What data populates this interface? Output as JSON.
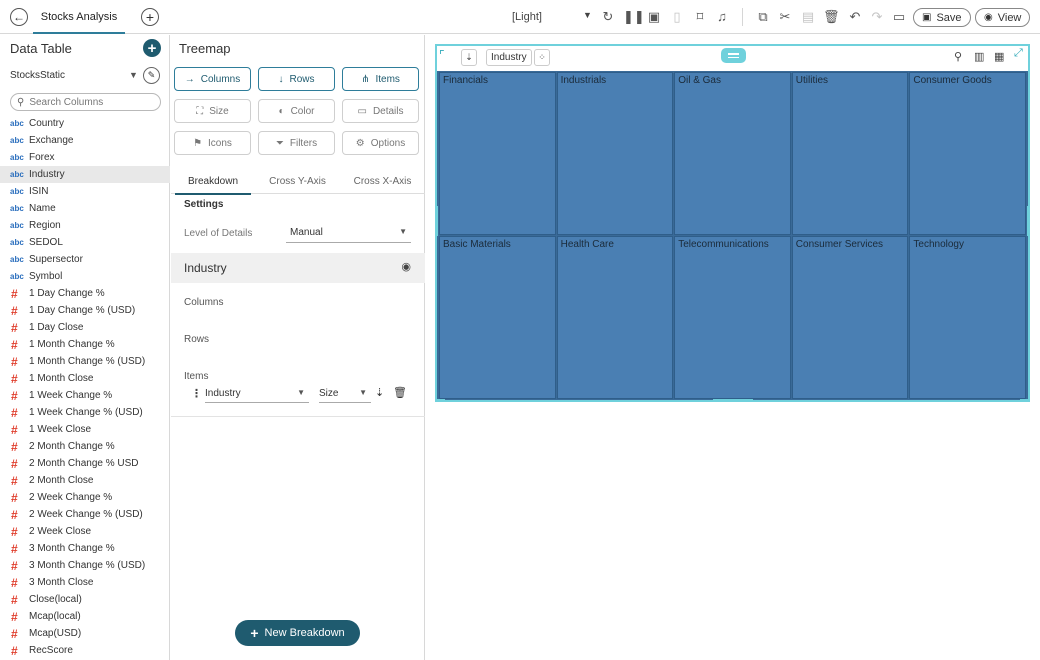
{
  "topbar": {
    "tab_label": "Stocks Analysis",
    "theme_value": "[Light]",
    "save_label": "Save",
    "view_label": "View"
  },
  "left_panel": {
    "title": "Data Table",
    "data_source": "StocksStatic",
    "search_placeholder": "Search Columns",
    "columns": [
      {
        "type": "abc",
        "name": "Country"
      },
      {
        "type": "abc",
        "name": "Exchange"
      },
      {
        "type": "abc",
        "name": "Forex"
      },
      {
        "type": "abc",
        "name": "Industry",
        "selected": true
      },
      {
        "type": "abc",
        "name": "ISIN"
      },
      {
        "type": "abc",
        "name": "Name"
      },
      {
        "type": "abc",
        "name": "Region"
      },
      {
        "type": "abc",
        "name": "SEDOL"
      },
      {
        "type": "abc",
        "name": "Supersector"
      },
      {
        "type": "abc",
        "name": "Symbol"
      },
      {
        "type": "#",
        "name": "1 Day Change %"
      },
      {
        "type": "#",
        "name": "1 Day Change % (USD)"
      },
      {
        "type": "#",
        "name": "1 Day Close"
      },
      {
        "type": "#",
        "name": "1 Month Change %"
      },
      {
        "type": "#",
        "name": "1 Month Change % (USD)"
      },
      {
        "type": "#",
        "name": "1 Month Close"
      },
      {
        "type": "#",
        "name": "1 Week Change %"
      },
      {
        "type": "#",
        "name": "1 Week Change % (USD)"
      },
      {
        "type": "#",
        "name": "1 Week Close"
      },
      {
        "type": "#",
        "name": "2 Month Change %"
      },
      {
        "type": "#",
        "name": "2 Month Change % USD"
      },
      {
        "type": "#",
        "name": "2 Month Close"
      },
      {
        "type": "#",
        "name": "2 Week Change %"
      },
      {
        "type": "#",
        "name": "2 Week Change % (USD)"
      },
      {
        "type": "#",
        "name": "2 Week Close"
      },
      {
        "type": "#",
        "name": "3 Month Change %"
      },
      {
        "type": "#",
        "name": "3 Month Change % (USD)"
      },
      {
        "type": "#",
        "name": "3 Month Close"
      },
      {
        "type": "#",
        "name": "Close(local)"
      },
      {
        "type": "#",
        "name": "Mcap(local)"
      },
      {
        "type": "#",
        "name": "Mcap(USD)"
      },
      {
        "type": "#",
        "name": "RecScore"
      }
    ]
  },
  "mid_panel": {
    "title": "Treemap",
    "buttons": {
      "columns": "Columns",
      "rows": "Rows",
      "items": "Items",
      "size": "Size",
      "color": "Color",
      "details": "Details",
      "icons": "Icons",
      "filters": "Filters",
      "options": "Options"
    },
    "tabs": [
      "Breakdown",
      "Cross Y-Axis",
      "Cross X-Axis"
    ],
    "settings_label": "Settings",
    "level_of_details_label": "Level of Details",
    "level_of_details_value": "Manual",
    "section_title": "Industry",
    "columns_label": "Columns",
    "rows_label": "Rows",
    "items_label": "Items",
    "item_field": "Industry",
    "item_size": "Size",
    "new_breakdown_label": "New Breakdown"
  },
  "canvas": {
    "breakdown_chip": "Industry",
    "accent_color": "#6fd1dc",
    "cell_color": "#4a7fb3",
    "treemap_cells": [
      "Financials",
      "Industrials",
      "Oil & Gas",
      "Utilities",
      "Consumer Goods",
      "Basic Materials",
      "Health Care",
      "Telecommunications",
      "Consumer Services",
      "Technology"
    ]
  }
}
